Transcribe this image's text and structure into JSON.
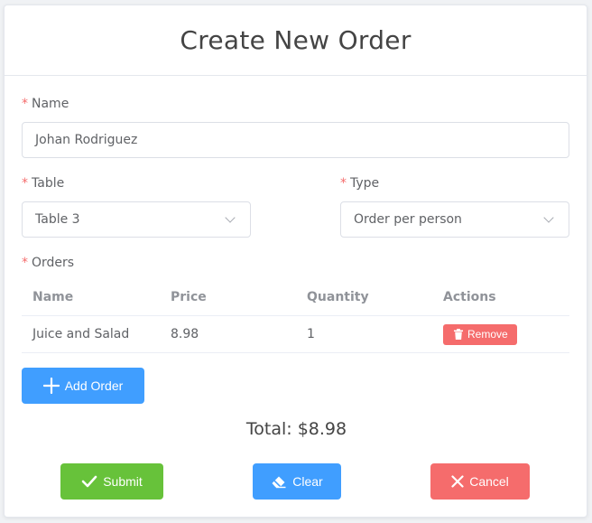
{
  "title": "Create New Order",
  "form": {
    "required_mark": "*",
    "name": {
      "label": "Name",
      "value": "Johan Rodriguez"
    },
    "table": {
      "label": "Table",
      "value": "Table 3"
    },
    "type": {
      "label": "Type",
      "value": "Order per person"
    },
    "orders": {
      "label": "Orders",
      "columns": [
        "Name",
        "Price",
        "Quantity",
        "Actions"
      ],
      "rows": [
        {
          "name": "Juice and Salad",
          "price": "8.98",
          "quantity": "1",
          "action": "Remove"
        }
      ]
    }
  },
  "buttons": {
    "add_order": "Add Order",
    "submit": "Submit",
    "clear": "Clear",
    "cancel": "Cancel"
  },
  "total": "Total: $8.98",
  "icons": {
    "add": "plus-icon",
    "remove": "trash-icon",
    "submit": "check-icon",
    "clear": "eraser-icon",
    "cancel": "close-icon",
    "select": "chevron-down-icon"
  },
  "colors": {
    "primary": "#409eff",
    "success": "#67c23a",
    "danger": "#f56c6c",
    "required": "#f56c6c"
  }
}
